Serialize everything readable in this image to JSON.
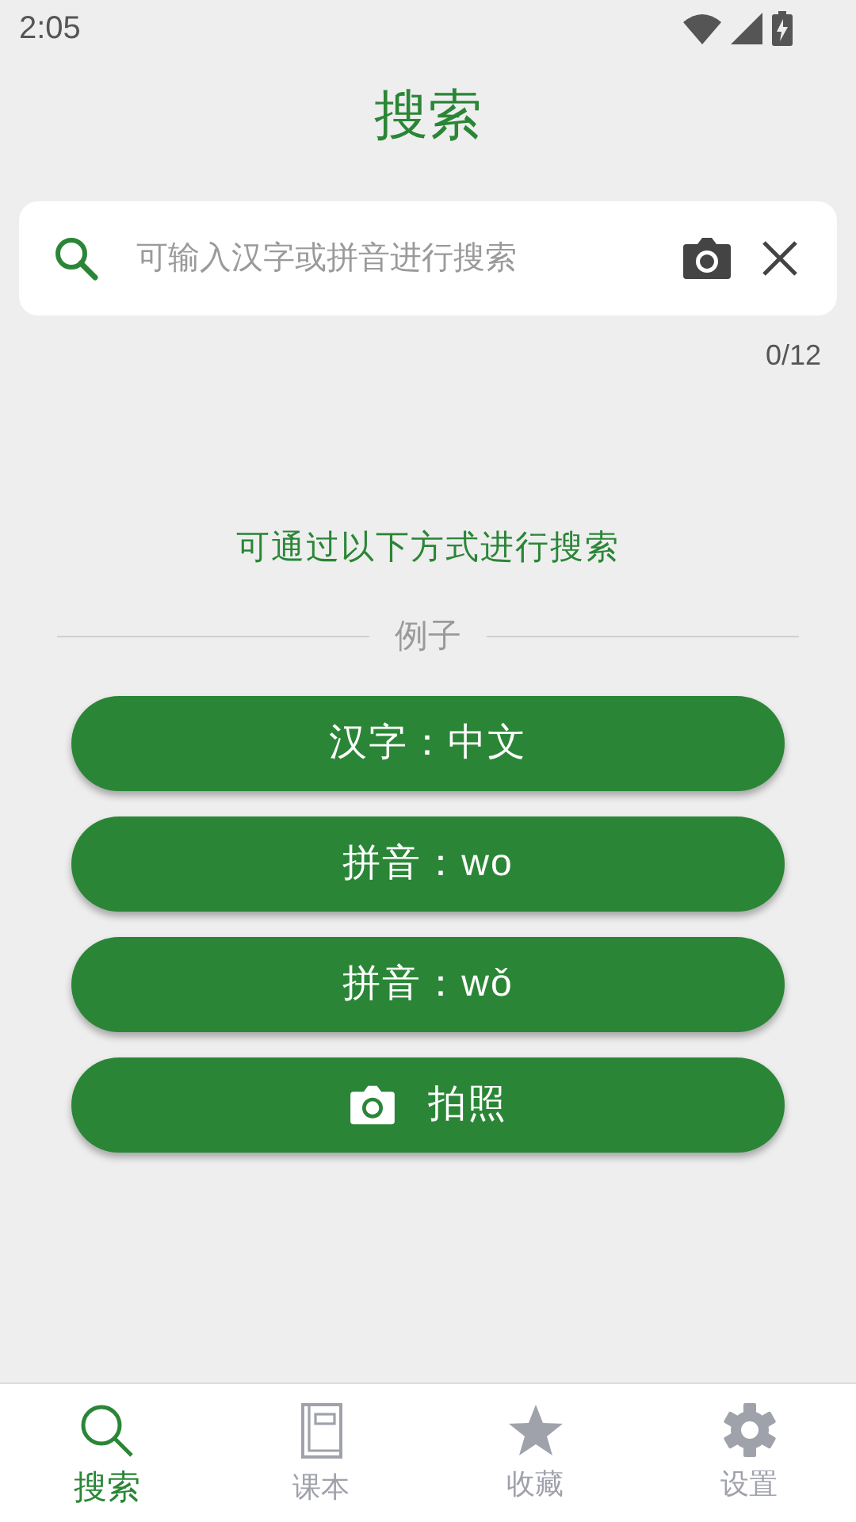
{
  "status_bar": {
    "time": "2:05"
  },
  "title": "搜索",
  "search": {
    "placeholder": "可输入汉字或拼音进行搜索",
    "counter": "0/12"
  },
  "hint": "可通过以下方式进行搜索",
  "divider_label": "例子",
  "examples": [
    {
      "kind": "text",
      "label": "汉字：中文"
    },
    {
      "kind": "text",
      "label": "拼音：wo"
    },
    {
      "kind": "text",
      "label": "拼音：wǒ"
    },
    {
      "kind": "photo",
      "label": "拍照"
    }
  ],
  "tabs": [
    {
      "label": "搜索",
      "selected": true
    },
    {
      "label": "课本",
      "selected": false
    },
    {
      "label": "收藏",
      "selected": false
    },
    {
      "label": "设置",
      "selected": false
    }
  ]
}
